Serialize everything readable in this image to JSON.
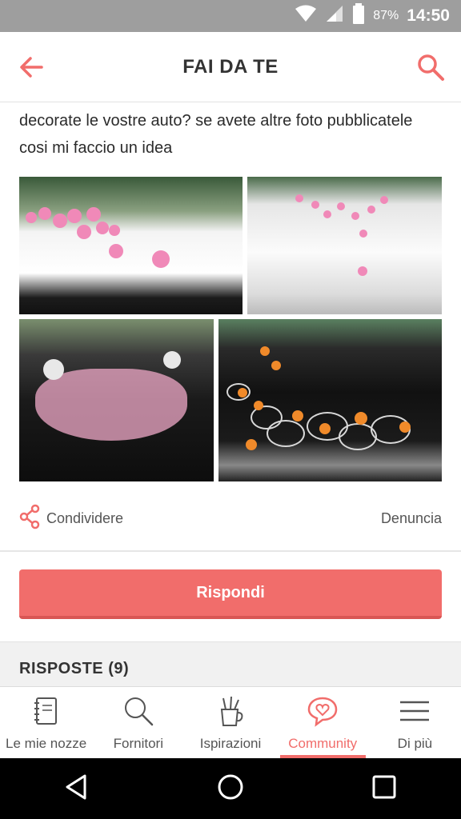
{
  "status_bar": {
    "battery": "87%",
    "time": "14:50"
  },
  "header": {
    "title": "FAI DA TE"
  },
  "post": {
    "text": "decorate le vostre auto? se avete altre foto pubblicatele cosi mi faccio un idea"
  },
  "actions": {
    "share_label": "Condividere",
    "report_label": "Denuncia",
    "reply_label": "Rispondi"
  },
  "answers": {
    "label": "RISPOSTE (9)"
  },
  "nav": {
    "items": [
      {
        "label": "Le mie nozze",
        "icon": "notebook-icon"
      },
      {
        "label": "Fornitori",
        "icon": "search-icon"
      },
      {
        "label": "Ispirazioni",
        "icon": "pencil-cup-icon"
      },
      {
        "label": "Community",
        "icon": "chat-heart-icon",
        "active": true
      },
      {
        "label": "Di più",
        "icon": "menu-icon"
      }
    ]
  },
  "colors": {
    "accent": "#f16d6b",
    "status_bar": "#9e9e9e",
    "system_nav": "#000000"
  }
}
